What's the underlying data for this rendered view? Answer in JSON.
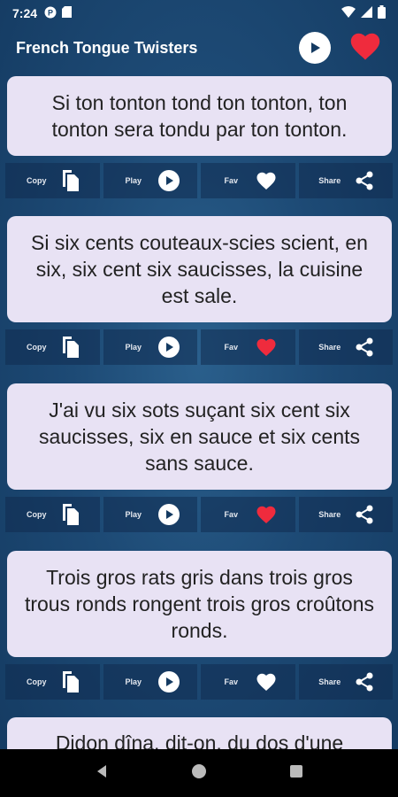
{
  "status_bar": {
    "time": "7:24"
  },
  "app_bar": {
    "title": "French Tongue Twisters"
  },
  "actions": {
    "copy": "Copy",
    "play": "Play",
    "fav": "Fav",
    "share": "Share"
  },
  "colors": {
    "heart": "#ef2b3d",
    "card": "#e8e2f4",
    "background": "#1d4a75"
  },
  "twisters": [
    {
      "text": "Si ton tonton tond ton tonton, ton tonton sera tondu par ton tonton.",
      "fav": false
    },
    {
      "text": "Si six cents couteaux-scies scient, en six, six cent six saucisses, la cuisine est sale.",
      "fav": true
    },
    {
      "text": "J'ai vu six sots suçant six cent six saucisses, six en sauce et six cents sans sauce.",
      "fav": true
    },
    {
      "text": "Trois gros rats gris dans trois gros trous ronds rongent trois gros croûtons ronds.",
      "fav": false
    },
    {
      "text": "Didon dîna, dit-on, du dos d'une",
      "fav": false
    }
  ]
}
